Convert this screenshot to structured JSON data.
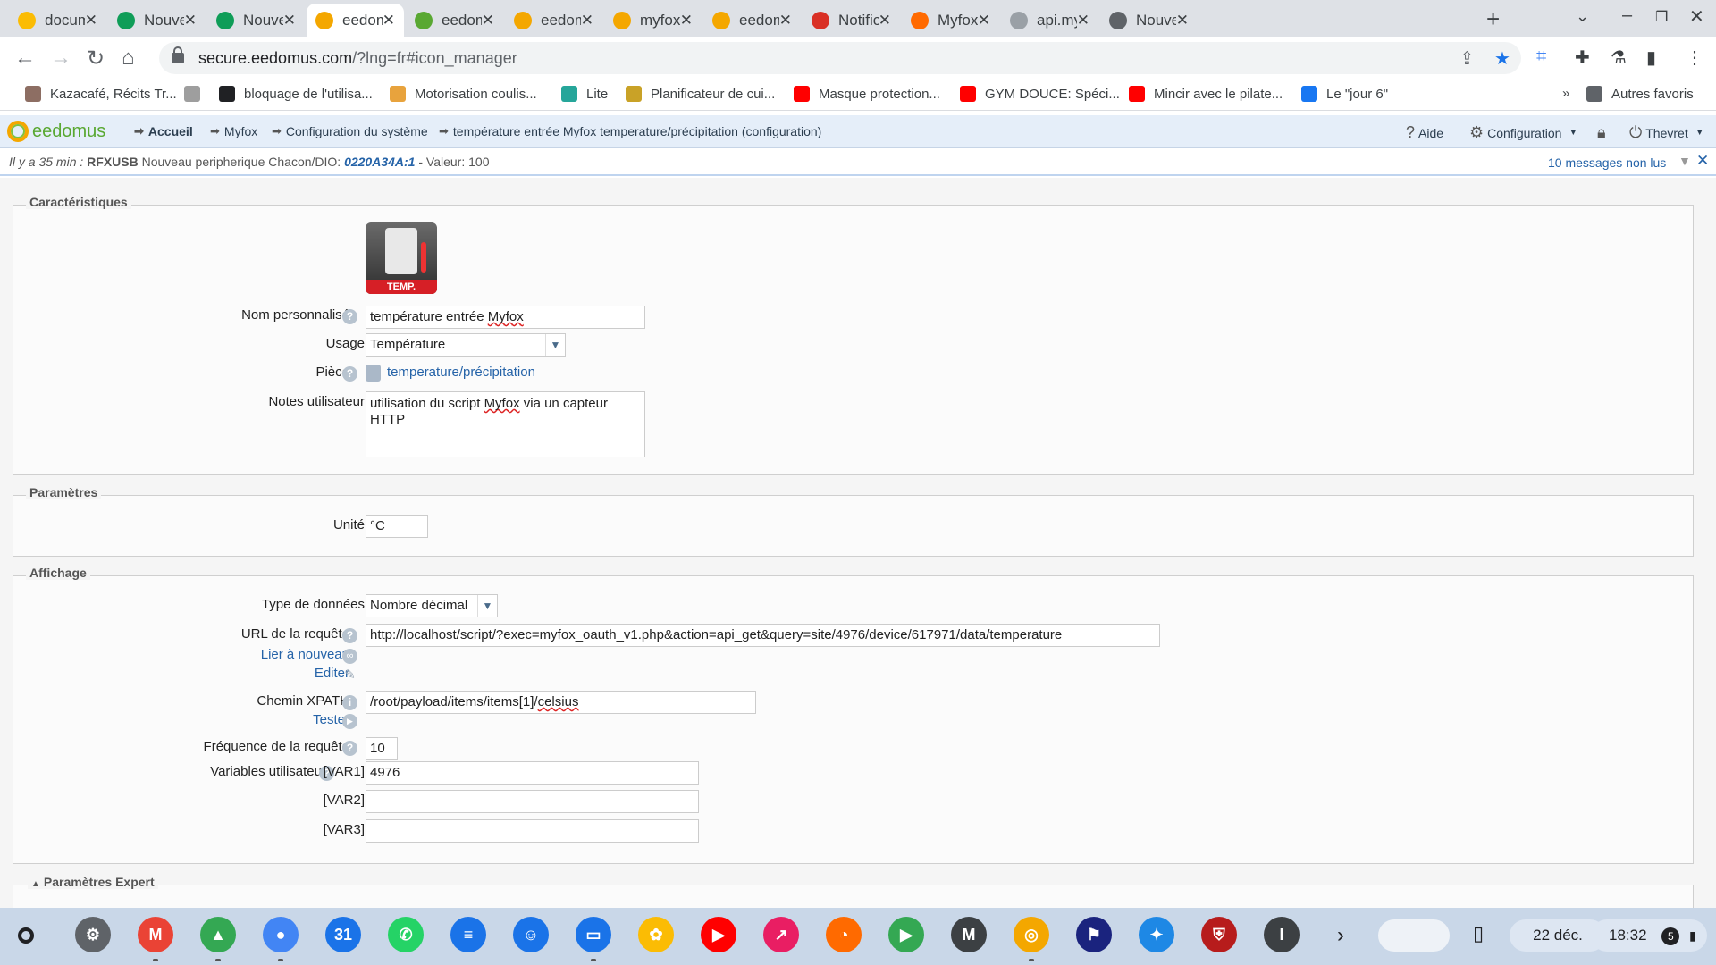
{
  "browser": {
    "tabs": [
      {
        "label": "documer",
        "color": "#fbbc04"
      },
      {
        "label": "Nouvel o",
        "color": "#0f9d58"
      },
      {
        "label": "Nouvel o",
        "color": "#0f9d58"
      },
      {
        "label": "eedomu",
        "color": "#f4a700",
        "active": true
      },
      {
        "label": "eedomu",
        "color": "#59a832"
      },
      {
        "label": "eedomu",
        "color": "#f4a700"
      },
      {
        "label": "myfox_o",
        "color": "#f4a700"
      },
      {
        "label": "eedomu",
        "color": "#f4a700"
      },
      {
        "label": "Notificat",
        "color": "#d93025"
      },
      {
        "label": "Myfox A",
        "color": "#ff6a00"
      },
      {
        "label": "api.myfo",
        "color": "#9aa0a6"
      },
      {
        "label": "Nouvel o",
        "color": "#5f6368"
      }
    ],
    "url_host": "secure.eedomus.com",
    "url_path": "/?lng=fr#icon_manager",
    "bookmarks": [
      {
        "label": "Kazacafé, Récits Tr...",
        "color": "#8d6e63"
      },
      {
        "label": "",
        "color": "#9e9e9e"
      },
      {
        "label": "bloquage de l'utilisa...",
        "color": "#202124"
      },
      {
        "label": "Motorisation coulis...",
        "color": "#e8a33d"
      },
      {
        "label": "Lite",
        "color": "#26a69a"
      },
      {
        "label": "Planificateur de cui...",
        "color": "#c9a227"
      },
      {
        "label": "Masque protection...",
        "color": "#ff0000"
      },
      {
        "label": "GYM DOUCE: Spéci...",
        "color": "#ff0000"
      },
      {
        "label": "Mincir avec le pilate...",
        "color": "#ff0000"
      },
      {
        "label": "Le \"jour 6\"",
        "color": "#1877f2"
      }
    ],
    "bookmarks_more": "»",
    "other_bookmarks": "Autres favoris"
  },
  "app_header": {
    "logo_text": "eedomus",
    "breadcrumbs": [
      "Accueil",
      "Myfox",
      "Configuration du système",
      "température entrée Myfox temperature/précipitation (configuration)"
    ],
    "help_label": "Aide",
    "config_label": "Configuration",
    "user_label": "Thevret"
  },
  "message": {
    "time": "Il y a 35 min :",
    "source": "RFXUSB",
    "text": "Nouveau peripherique Chacon/DIO:",
    "code": "0220A34A:1",
    "value_text": "- Valeur: 100",
    "unread": "10 messages non lus"
  },
  "characteristics": {
    "legend": "Caractéristiques",
    "icon_label": "TEMP.",
    "name_label": "Nom personnalisé",
    "name_value_prefix": "température entrée ",
    "name_value_word": "Myfox",
    "usage_label": "Usage",
    "usage_value": "Température",
    "room_label": "Pièce",
    "room_value": "temperature/précipitation",
    "notes_label": "Notes utilisateur",
    "notes_value_a": "utilisation du script ",
    "notes_value_word": "Myfox",
    "notes_value_b": " via un capteur HTTP"
  },
  "parameters": {
    "legend": "Paramètres",
    "unit_label": "Unité",
    "unit_value": "°C"
  },
  "display": {
    "legend": "Affichage",
    "datatype_label": "Type de données",
    "datatype_value": "Nombre décimal",
    "url_label": "URL de la requête",
    "url_value": "http://localhost/script/?exec=myfox_oauth_v1.php&action=api_get&query=site/4976/device/617971/data/temperature",
    "relink_label": "Lier à nouveau",
    "edit_label": "Editer",
    "xpath_label": "Chemin XPATH",
    "xpath_value_prefix": "/root/payload/items/items[1]/",
    "xpath_value_word": "celsius",
    "test_label": "Tester",
    "freq_label": "Fréquence de la requête",
    "freq_value": "10",
    "vars_label": "Variables utilisateur",
    "var1_label": "[VAR1]",
    "var1_value": "4976",
    "var2_label": "[VAR2]",
    "var2_value": "",
    "var3_label": "[VAR3]",
    "var3_value": ""
  },
  "expert": {
    "legend": "Paramètres Expert"
  },
  "shelf": {
    "apps": [
      {
        "name": "settings-app",
        "color": "#5f6368",
        "glyph": "⚙"
      },
      {
        "name": "gmail-app",
        "color": "#ea4335",
        "glyph": "M"
      },
      {
        "name": "drive-app",
        "color": "#34a853",
        "glyph": "▲"
      },
      {
        "name": "chrome-app",
        "color": "#4285f4",
        "glyph": "●"
      },
      {
        "name": "calendar-app",
        "color": "#1a73e8",
        "glyph": "31"
      },
      {
        "name": "whatsapp-app",
        "color": "#25d366",
        "glyph": "✆"
      },
      {
        "name": "messages-app",
        "color": "#1a73e8",
        "glyph": "≡"
      },
      {
        "name": "contacts-app",
        "color": "#1a73e8",
        "glyph": "☺"
      },
      {
        "name": "files-app",
        "color": "#1a73e8",
        "glyph": "▭"
      },
      {
        "name": "photos-app",
        "color": "#fbbc04",
        "glyph": "✿"
      },
      {
        "name": "youtube-app",
        "color": "#ff0000",
        "glyph": "▶"
      },
      {
        "name": "arrow-app",
        "color": "#e91e63",
        "glyph": "↗"
      },
      {
        "name": "orange-app",
        "color": "#ff6a00",
        "glyph": "◔"
      },
      {
        "name": "play-store-app",
        "color": "#34a853",
        "glyph": "▶"
      },
      {
        "name": "m-app",
        "color": "#3c4043",
        "glyph": "M"
      },
      {
        "name": "eedomus-app",
        "color": "#f4a700",
        "glyph": "◎"
      },
      {
        "name": "flag-app",
        "color": "#1a237e",
        "glyph": "⚑"
      },
      {
        "name": "bouygues-app",
        "color": "#1e88e5",
        "glyph": "✦"
      },
      {
        "name": "crest-app",
        "color": "#b71c1c",
        "glyph": "⛨"
      },
      {
        "name": "i-app",
        "color": "#3c4043",
        "glyph": "I"
      }
    ],
    "date": "22 déc.",
    "time": "18:32",
    "notif_count": "5"
  }
}
